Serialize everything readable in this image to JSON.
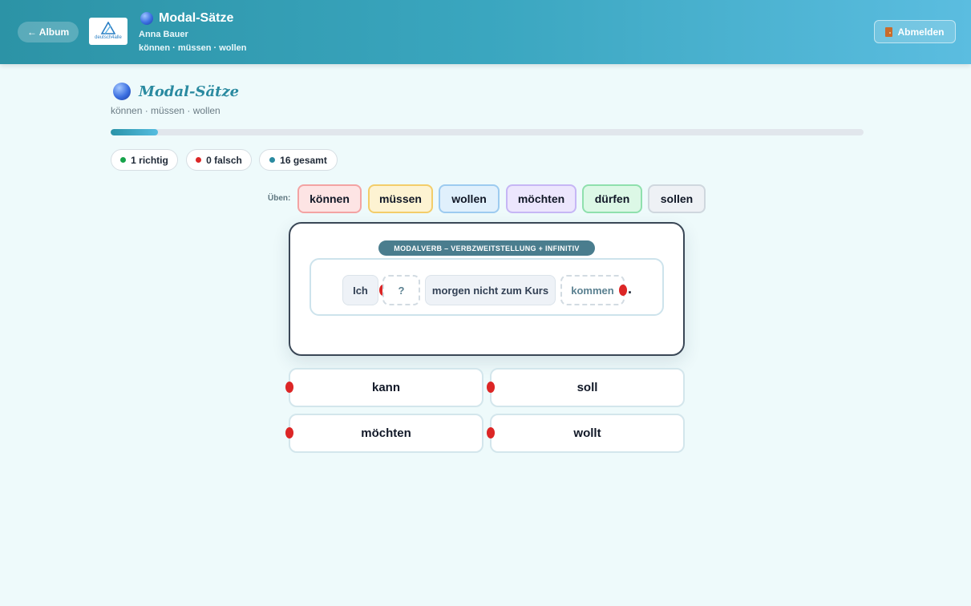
{
  "header": {
    "back_label": "← Album",
    "logo_text": "deutsch4alle",
    "title": "Modal-Sätze",
    "user": "Anna Bauer",
    "subtitle": "können · müssen · wollen",
    "logout_label": "Abmelden"
  },
  "page": {
    "title": "Modal-Sätze",
    "subtitle": "können · müssen · wollen",
    "progress_fraction": 0.0625
  },
  "stats": [
    {
      "label": "1 richtig",
      "color": "#16a34a"
    },
    {
      "label": "0 falsch",
      "color": "#dc2626"
    },
    {
      "label": "16 gesamt",
      "color": "#2a8aa0"
    }
  ],
  "practice": {
    "label": "Üben:",
    "verbs": [
      {
        "label": "können",
        "bg": "#fde4e4",
        "border": "#f3a3a3"
      },
      {
        "label": "müssen",
        "bg": "#fdf3d2",
        "border": "#f3cd6a"
      },
      {
        "label": "wollen",
        "bg": "#e0f0fc",
        "border": "#9dcbf0"
      },
      {
        "label": "möchten",
        "bg": "#ece6fd",
        "border": "#c6b6f5"
      },
      {
        "label": "dürfen",
        "bg": "#dcf8e6",
        "border": "#8fe0ad"
      },
      {
        "label": "sollen",
        "bg": "#eef1f5",
        "border": "#cfd7de"
      }
    ]
  },
  "exercise": {
    "badge": "MODALVERB – VERBZWEITSTELLUNG + INFINITIV",
    "tokens": [
      "Ich",
      "?",
      "morgen nicht zum Kurs",
      "kommen"
    ],
    "period": "."
  },
  "answers": [
    "kann",
    "soll",
    "möchten",
    "wollt"
  ]
}
